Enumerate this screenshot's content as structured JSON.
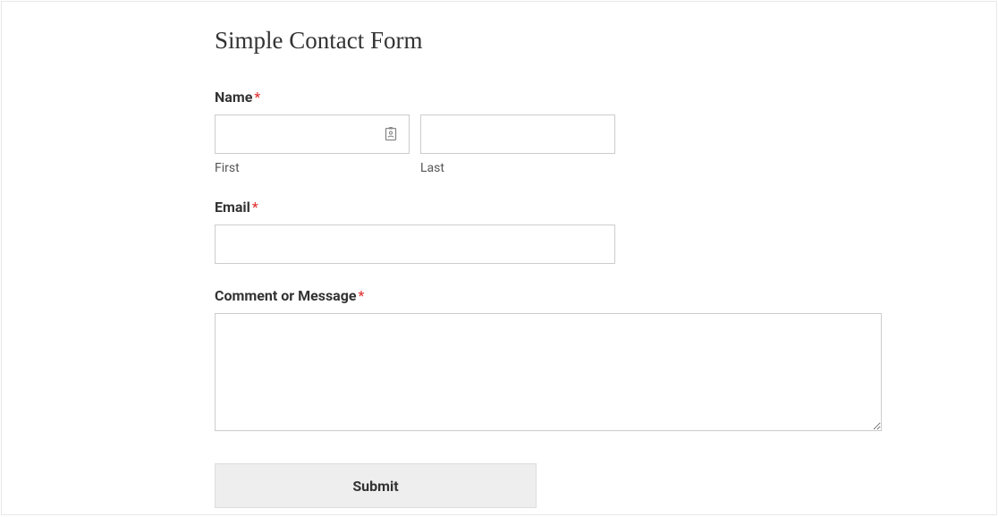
{
  "form": {
    "title": "Simple Contact Form",
    "required_mark": "*",
    "name": {
      "label": "Name",
      "first_sublabel": "First",
      "last_sublabel": "Last",
      "first_value": "",
      "last_value": ""
    },
    "email": {
      "label": "Email",
      "value": ""
    },
    "message": {
      "label": "Comment or Message",
      "value": ""
    },
    "submit": {
      "label": "Submit"
    }
  }
}
